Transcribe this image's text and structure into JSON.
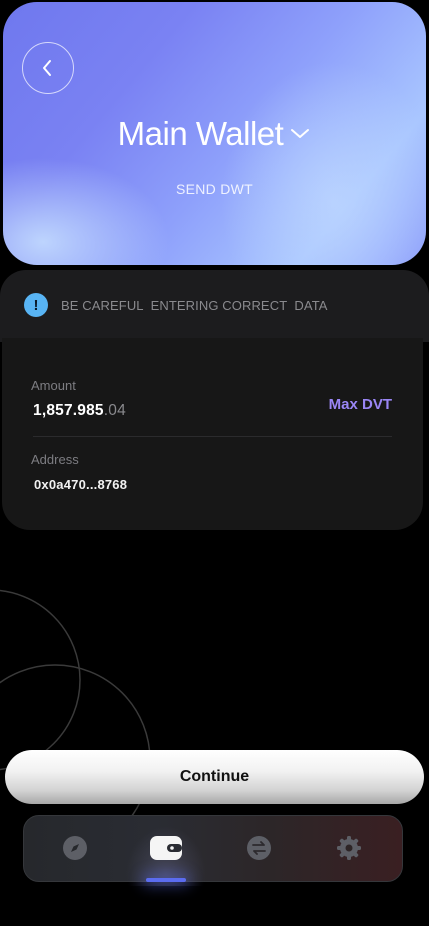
{
  "header": {
    "wallet_name": "Main Wallet",
    "subtitle": "SEND DWT"
  },
  "warning": {
    "icon": "info-icon",
    "glyph": "!",
    "text": "BE CAREFUL  ENTERING CORRECT  DATA"
  },
  "form": {
    "amount_label": "Amount",
    "amount_integer": "1,857.985",
    "amount_decimal": ".04",
    "max_label": "Max DVT",
    "address_label": "Address",
    "address_value": "0x0a470...8768"
  },
  "actions": {
    "continue_label": "Continue"
  },
  "nav": {
    "items": [
      {
        "icon": "compass-icon",
        "active": false
      },
      {
        "icon": "wallet-icon",
        "active": true
      },
      {
        "icon": "swap-icon",
        "active": false
      },
      {
        "icon": "gear-icon",
        "active": false
      }
    ]
  },
  "colors": {
    "accent": "#9a86f5",
    "info": "#58b4f4",
    "nav_active": "#5b6cf0"
  }
}
